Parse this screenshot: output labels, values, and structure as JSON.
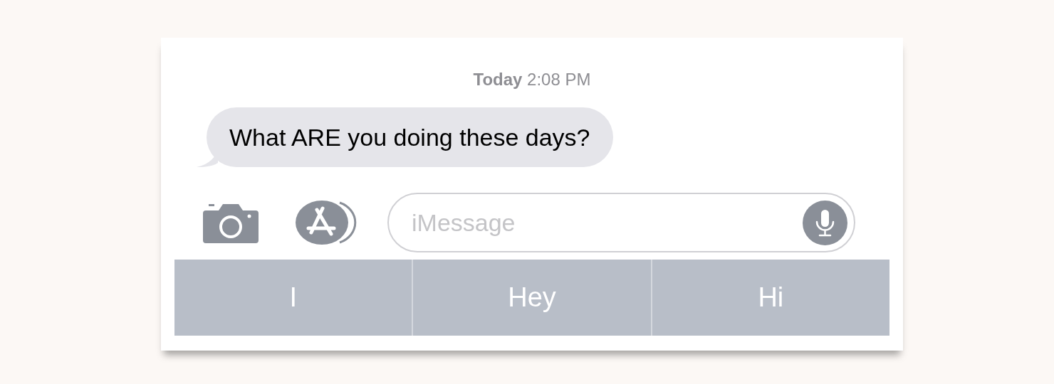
{
  "timestamp": "**Today** 2:08 PM",
  "messages": [
    {
      "text": "What ARE you doing these days?"
    }
  ],
  "input": {
    "placeholder": "iMessage"
  },
  "suggestions": [
    {
      "label": "I"
    },
    {
      "label": "Hey"
    },
    {
      "label": "Hi"
    }
  ]
}
